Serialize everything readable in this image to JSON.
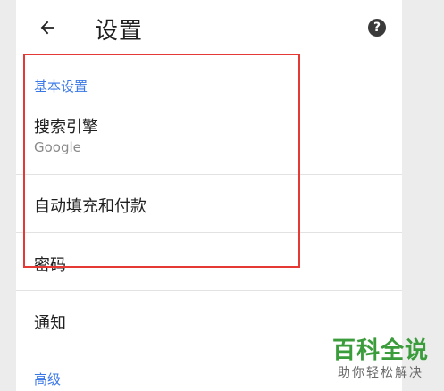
{
  "header": {
    "title": "设置",
    "back_icon": "arrow-left-icon",
    "help_label": "?",
    "help_icon": "help-circle-icon"
  },
  "sections": {
    "basic": {
      "header": "基本设置",
      "search_engine": {
        "title": "搜索引擎",
        "value": "Google"
      },
      "autofill": {
        "title": "自动填充和付款"
      },
      "passwords": {
        "title": "密码"
      }
    },
    "notifications": {
      "title": "通知"
    },
    "advanced": {
      "header": "高级"
    }
  },
  "watermark": {
    "title": "百科全说",
    "subtitle": "助你轻松解决"
  },
  "colors": {
    "accent": "#3b78e7",
    "highlight_border": "#e53935",
    "watermark_green": "#3a9c3a"
  }
}
